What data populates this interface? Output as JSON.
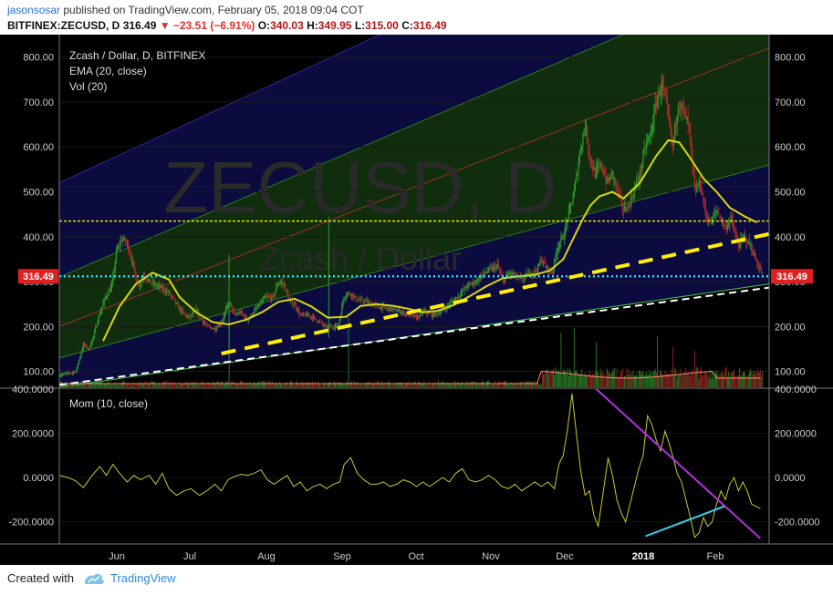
{
  "header": {
    "user": "jasonsosar",
    "published_text": "published on TradingView.com, February 05, 2018 09:04 COT",
    "symbol": "BITFINEX:ZECUSD, D",
    "last": "316.49",
    "change_arrow": "▼",
    "change": "−23.51 (−6.91%)",
    "o_label": "O:",
    "o": "340.03",
    "h_label": "H:",
    "h": "349.95",
    "l_label": "L:",
    "l": "315.00",
    "c_label": "C:",
    "c": "316.49"
  },
  "chart_data": {
    "type": "candlestick",
    "title": "Zcash / Dollar, D, BITFINEX",
    "watermark": "ZECUSD, D",
    "watermark_sub": "Zcash / Dollar",
    "indicators": [
      "EMA (20, close)",
      "Vol (20)"
    ],
    "price_label": "316.49",
    "x_tick_labels": [
      "Jun",
      "Jul",
      "Aug",
      "Sep",
      "Oct",
      "Nov",
      "Dec",
      "2018",
      "Feb"
    ],
    "y_tick_labels": [
      "800.00",
      "700.00",
      "600.00",
      "500.00",
      "400.00",
      "300.00",
      "200.00",
      "100.00"
    ],
    "y_ticks": [
      800,
      700,
      600,
      500,
      400,
      300,
      200,
      100
    ],
    "ylim": [
      65,
      850
    ],
    "close_path": [
      [
        0,
        92
      ],
      [
        15,
        100
      ],
      [
        22,
        160
      ],
      [
        27,
        150
      ],
      [
        32,
        185
      ],
      [
        35,
        215
      ],
      [
        42,
        265
      ],
      [
        48,
        290
      ],
      [
        52,
        365
      ],
      [
        57,
        395
      ],
      [
        62,
        385
      ],
      [
        67,
        340
      ],
      [
        72,
        290
      ],
      [
        77,
        315
      ],
      [
        82,
        300
      ],
      [
        90,
        290
      ],
      [
        100,
        275
      ],
      [
        108,
        245
      ],
      [
        113,
        230
      ],
      [
        118,
        220
      ],
      [
        125,
        235
      ],
      [
        130,
        215
      ],
      [
        135,
        200
      ],
      [
        142,
        195
      ],
      [
        148,
        210
      ],
      [
        155,
        255
      ],
      [
        160,
        225
      ],
      [
        165,
        232
      ],
      [
        172,
        215
      ],
      [
        180,
        240
      ],
      [
        188,
        265
      ],
      [
        195,
        265
      ],
      [
        200,
        300
      ],
      [
        205,
        295
      ],
      [
        210,
        255
      ],
      [
        215,
        250
      ],
      [
        220,
        225
      ],
      [
        228,
        225
      ],
      [
        232,
        220
      ],
      [
        238,
        210
      ],
      [
        243,
        198
      ],
      [
        249,
        200
      ],
      [
        255,
        205
      ],
      [
        260,
        270
      ],
      [
        266,
        275
      ],
      [
        271,
        260
      ],
      [
        280,
        255
      ],
      [
        290,
        245
      ],
      [
        300,
        240
      ],
      [
        310,
        235
      ],
      [
        318,
        228
      ],
      [
        326,
        220
      ],
      [
        333,
        235
      ],
      [
        340,
        225
      ],
      [
        350,
        235
      ],
      [
        358,
        255
      ],
      [
        365,
        270
      ],
      [
        372,
        290
      ],
      [
        380,
        300
      ],
      [
        388,
        320
      ],
      [
        396,
        330
      ],
      [
        400,
        335
      ],
      [
        405,
        300
      ],
      [
        410,
        320
      ],
      [
        415,
        315
      ],
      [
        420,
        305
      ],
      [
        425,
        310
      ],
      [
        430,
        320
      ],
      [
        436,
        325
      ],
      [
        440,
        350
      ],
      [
        445,
        330
      ],
      [
        450,
        320
      ],
      [
        455,
        380
      ],
      [
        460,
        400
      ],
      [
        466,
        460
      ],
      [
        470,
        500
      ],
      [
        476,
        600
      ],
      [
        480,
        650
      ],
      [
        485,
        570
      ],
      [
        489,
        540
      ],
      [
        495,
        560
      ],
      [
        500,
        520
      ],
      [
        505,
        540
      ],
      [
        510,
        500
      ],
      [
        515,
        460
      ],
      [
        520,
        470
      ],
      [
        530,
        540
      ],
      [
        535,
        600
      ],
      [
        540,
        630
      ],
      [
        545,
        700
      ],
      [
        550,
        740
      ],
      [
        555,
        680
      ],
      [
        560,
        600
      ],
      [
        565,
        700
      ],
      [
        570,
        680
      ],
      [
        575,
        640
      ],
      [
        580,
        500
      ],
      [
        585,
        520
      ],
      [
        590,
        450
      ],
      [
        595,
        430
      ],
      [
        600,
        460
      ],
      [
        608,
        420
      ],
      [
        613,
        440
      ],
      [
        620,
        380
      ],
      [
        625,
        400
      ],
      [
        631,
        380
      ],
      [
        637,
        340
      ],
      [
        642,
        316
      ]
    ],
    "ema_path": [
      [
        40,
        168
      ],
      [
        55,
        245
      ],
      [
        70,
        295
      ],
      [
        85,
        320
      ],
      [
        100,
        305
      ],
      [
        110,
        265
      ],
      [
        125,
        232
      ],
      [
        140,
        210
      ],
      [
        155,
        205
      ],
      [
        170,
        215
      ],
      [
        185,
        232
      ],
      [
        200,
        255
      ],
      [
        215,
        262
      ],
      [
        230,
        245
      ],
      [
        245,
        220
      ],
      [
        262,
        222
      ],
      [
        275,
        246
      ],
      [
        290,
        250
      ],
      [
        305,
        246
      ],
      [
        318,
        240
      ],
      [
        332,
        232
      ],
      [
        345,
        235
      ],
      [
        360,
        248
      ],
      [
        375,
        268
      ],
      [
        390,
        290
      ],
      [
        405,
        308
      ],
      [
        420,
        312
      ],
      [
        435,
        316
      ],
      [
        448,
        325
      ],
      [
        460,
        350
      ],
      [
        470,
        400
      ],
      [
        478,
        440
      ],
      [
        485,
        470
      ],
      [
        493,
        490
      ],
      [
        505,
        500
      ],
      [
        515,
        485
      ],
      [
        530,
        520
      ],
      [
        545,
        580
      ],
      [
        556,
        615
      ],
      [
        566,
        610
      ],
      [
        576,
        575
      ],
      [
        588,
        530
      ],
      [
        600,
        500
      ],
      [
        612,
        465
      ],
      [
        626,
        445
      ],
      [
        637,
        432
      ]
    ],
    "volume_spikes": [
      [
        155,
        1.0
      ],
      [
        264,
        0.95
      ],
      [
        458,
        0.75
      ],
      [
        470,
        0.82
      ],
      [
        490,
        0.62
      ],
      [
        546,
        0.7
      ],
      [
        560,
        0.55
      ],
      [
        580,
        0.5
      ]
    ],
    "levels": [
      {
        "name": "resistance-line",
        "value": 435,
        "color": "#e8e000"
      },
      {
        "name": "current-price-line",
        "value": 312,
        "color": "#35d6f0"
      }
    ],
    "trendlines": [
      {
        "name": "yellow-dashed-trend",
        "color": "#ffef00",
        "from": [
          148,
          140
        ],
        "to": [
          702,
          435
        ]
      },
      {
        "name": "white-dashed-trend",
        "color": "#ffffff",
        "from": [
          0,
          70
        ],
        "to": [
          717,
          310
        ]
      }
    ],
    "momentum": {
      "title": "Mom (10, close)",
      "y_tick_labels": [
        "400.0000",
        "200.0000",
        "0.0000",
        "-200.0000"
      ],
      "y_ticks": [
        400,
        200,
        0,
        -200
      ],
      "ylim": [
        -300,
        400
      ],
      "line_color": "#c8c832",
      "path": [
        [
          0,
          10
        ],
        [
          8,
          0
        ],
        [
          15,
          -15
        ],
        [
          22,
          -45
        ],
        [
          30,
          10
        ],
        [
          37,
          50
        ],
        [
          43,
          10
        ],
        [
          49,
          60
        ],
        [
          55,
          20
        ],
        [
          62,
          -20
        ],
        [
          68,
          10
        ],
        [
          74,
          -10
        ],
        [
          82,
          10
        ],
        [
          88,
          -30
        ],
        [
          94,
          20
        ],
        [
          100,
          -50
        ],
        [
          107,
          -80
        ],
        [
          114,
          -60
        ],
        [
          120,
          -50
        ],
        [
          128,
          -80
        ],
        [
          136,
          -55
        ],
        [
          142,
          -30
        ],
        [
          148,
          -60
        ],
        [
          154,
          -10
        ],
        [
          160,
          5
        ],
        [
          166,
          15
        ],
        [
          172,
          10
        ],
        [
          178,
          20
        ],
        [
          184,
          35
        ],
        [
          190,
          -10
        ],
        [
          196,
          -30
        ],
        [
          202,
          -10
        ],
        [
          208,
          10
        ],
        [
          214,
          -40
        ],
        [
          220,
          -20
        ],
        [
          226,
          -60
        ],
        [
          232,
          -40
        ],
        [
          238,
          -30
        ],
        [
          244,
          -50
        ],
        [
          250,
          -30
        ],
        [
          256,
          -20
        ],
        [
          260,
          60
        ],
        [
          266,
          90
        ],
        [
          272,
          20
        ],
        [
          278,
          -10
        ],
        [
          284,
          -30
        ],
        [
          290,
          -30
        ],
        [
          296,
          -20
        ],
        [
          302,
          -40
        ],
        [
          308,
          -30
        ],
        [
          314,
          -10
        ],
        [
          320,
          -20
        ],
        [
          326,
          -40
        ],
        [
          332,
          -20
        ],
        [
          338,
          -40
        ],
        [
          344,
          -20
        ],
        [
          350,
          0
        ],
        [
          356,
          -20
        ],
        [
          362,
          20
        ],
        [
          368,
          40
        ],
        [
          374,
          -10
        ],
        [
          380,
          -20
        ],
        [
          386,
          -10
        ],
        [
          392,
          10
        ],
        [
          398,
          -10
        ],
        [
          404,
          -40
        ],
        [
          410,
          -50
        ],
        [
          416,
          -30
        ],
        [
          422,
          -60
        ],
        [
          428,
          -40
        ],
        [
          434,
          -20
        ],
        [
          440,
          -40
        ],
        [
          446,
          -20
        ],
        [
          452,
          -50
        ],
        [
          456,
          60
        ],
        [
          460,
          100
        ],
        [
          464,
          220
        ],
        [
          468,
          380
        ],
        [
          472,
          200
        ],
        [
          476,
          30
        ],
        [
          480,
          -80
        ],
        [
          484,
          -60
        ],
        [
          488,
          -170
        ],
        [
          492,
          -220
        ],
        [
          497,
          -50
        ],
        [
          501,
          90
        ],
        [
          505,
          10
        ],
        [
          509,
          -100
        ],
        [
          513,
          -160
        ],
        [
          517,
          -200
        ],
        [
          521,
          -120
        ],
        [
          525,
          -40
        ],
        [
          529,
          40
        ],
        [
          533,
          100
        ],
        [
          537,
          280
        ],
        [
          541,
          240
        ],
        [
          545,
          170
        ],
        [
          549,
          120
        ],
        [
          553,
          210
        ],
        [
          557,
          150
        ],
        [
          561,
          80
        ],
        [
          564,
          20
        ],
        [
          568,
          -20
        ],
        [
          572,
          -100
        ],
        [
          576,
          -180
        ],
        [
          580,
          -270
        ],
        [
          584,
          -250
        ],
        [
          588,
          -180
        ],
        [
          592,
          -220
        ],
        [
          596,
          -200
        ],
        [
          600,
          -120
        ],
        [
          604,
          -60
        ],
        [
          608,
          -100
        ],
        [
          612,
          -30
        ],
        [
          616,
          0
        ],
        [
          620,
          -60
        ],
        [
          624,
          -20
        ],
        [
          628,
          -60
        ],
        [
          632,
          -120
        ],
        [
          636,
          -130
        ],
        [
          640,
          -140
        ]
      ]
    },
    "mom_trendlines": [
      {
        "name": "mom-purple-trend",
        "color": "#b530e0",
        "from": [
          488,
          410
        ],
        "to": [
          640,
          -275
        ]
      },
      {
        "name": "mom-cyan-trend",
        "color": "#35d6f0",
        "from": [
          535,
          -265
        ],
        "to": [
          607,
          -130
        ]
      }
    ],
    "bands": [
      {
        "name": "outer-band-blue",
        "color": "#2c2c9a"
      },
      {
        "name": "green-band",
        "color": "#2a7a26"
      },
      {
        "name": "red-median",
        "color": "#a0301f"
      }
    ]
  },
  "footer": {
    "created_with": "Created with",
    "brand": "TradingView"
  },
  "colors": {
    "bg": "#000000",
    "up": "#2e9b2e",
    "down": "#b02a2a",
    "ema": "#d6d60e",
    "volume_ema": "#ff8c6a",
    "blue_fill": "#0b0b40",
    "green_fill": "#102e0e"
  }
}
